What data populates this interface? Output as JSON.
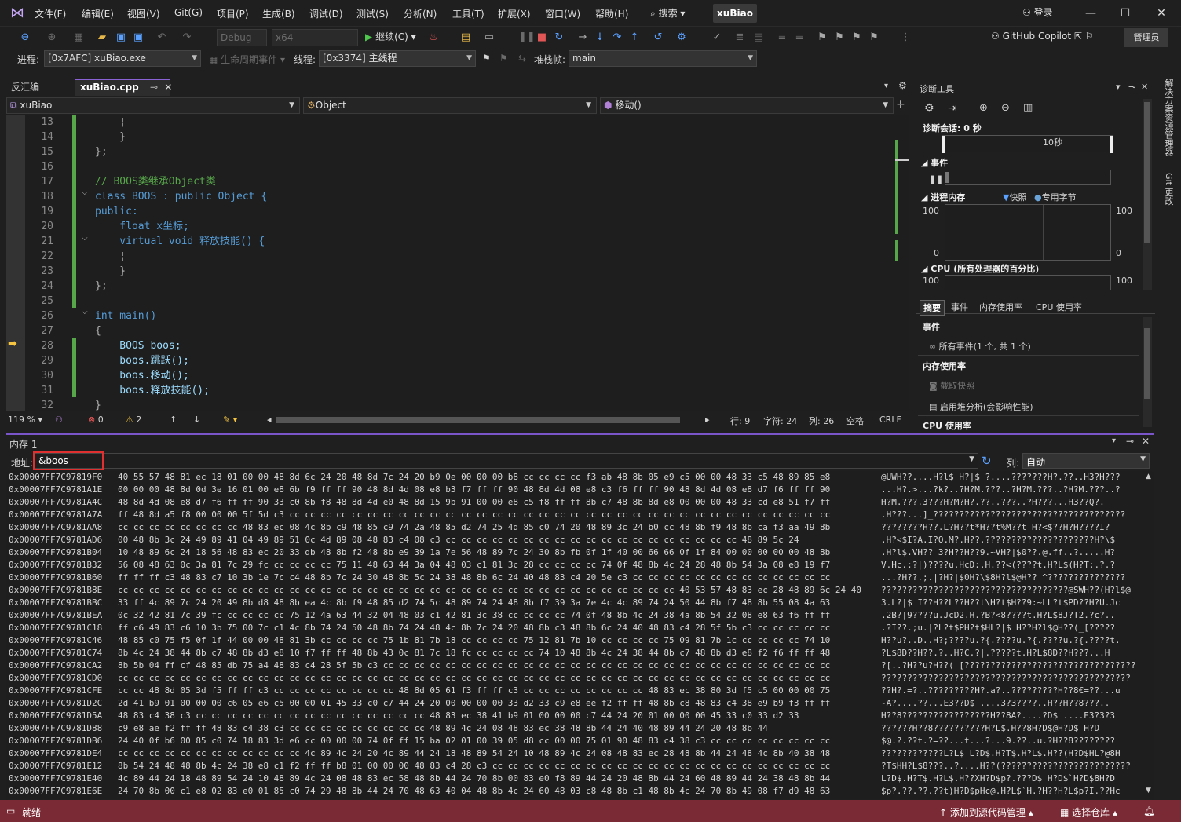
{
  "window": {
    "menu": [
      "文件(F)",
      "编辑(E)",
      "视图(V)",
      "Git(G)",
      "项目(P)",
      "生成(B)",
      "调试(D)",
      "测试(S)",
      "分析(N)",
      "工具(T)",
      "扩展(X)",
      "窗口(W)",
      "帮助(H)"
    ],
    "search_label": "搜索",
    "solution_name": "xuBiao",
    "login_label": "登录",
    "minimize": "—",
    "maximize": "☐",
    "close": "✕"
  },
  "toolbar": {
    "config": "Debug",
    "platform": "x64",
    "continue_label": "继续(C)",
    "copilot_label": "GitHub Copilot",
    "admin_label": "管理员"
  },
  "debug_location": {
    "process_label": "进程:",
    "process_value": "[0x7AFC] xuBiao.exe",
    "lifecycle_label": "生命周期事件",
    "thread_label": "线程:",
    "thread_value": "[0x3374] 主线程",
    "stackframe_label": "堆栈帧:",
    "stackframe_value": "main"
  },
  "tabs": {
    "disassembly": "反汇编",
    "code_file": "xuBiao.cpp"
  },
  "navbar": {
    "project": "xuBiao",
    "scope": "Object",
    "member": "移动()"
  },
  "code_lines": [
    {
      "n": "13",
      "t": "    ¦"
    },
    {
      "n": "14",
      "t": "    }"
    },
    {
      "n": "15",
      "t": "};"
    },
    {
      "n": "16",
      "t": ""
    },
    {
      "n": "17",
      "t": "// BOOS类继承Object类"
    },
    {
      "n": "18",
      "t": "class BOOS : public Object {"
    },
    {
      "n": "19",
      "t": "public:"
    },
    {
      "n": "20",
      "t": "    float x坐标;"
    },
    {
      "n": "21",
      "t": "    virtual void 释放技能() {"
    },
    {
      "n": "22",
      "t": "    ¦"
    },
    {
      "n": "23",
      "t": "    }"
    },
    {
      "n": "24",
      "t": "};"
    },
    {
      "n": "25",
      "t": ""
    },
    {
      "n": "26",
      "t": "int main()"
    },
    {
      "n": "27",
      "t": "{"
    },
    {
      "n": "28",
      "t": "    BOOS boos;"
    },
    {
      "n": "29",
      "t": "    boos.跳跃();"
    },
    {
      "n": "30",
      "t": "    boos.移动();"
    },
    {
      "n": "31",
      "t": "    boos.释放技能();"
    },
    {
      "n": "32",
      "t": "}"
    }
  ],
  "editor_status": {
    "zoom": "119 %",
    "errors": "0",
    "warnings": "2",
    "line": "行: 9",
    "char": "字符: 24",
    "col": "列: 26",
    "whitespace": "空格",
    "eol": "CRLF"
  },
  "diagnostics": {
    "title": "诊断工具",
    "session": "诊断会话: 0 秒",
    "timeline_label": "10秒",
    "events_label": "事件",
    "proc_mem_label": "进程内存",
    "snapshot_label": "快照",
    "private_bytes_label": "专用字节",
    "mem_max": "100",
    "mem_min": "0",
    "cpu_label": "CPU (所有处理器的百分比)",
    "cpu_max": "100",
    "tabs": [
      "摘要",
      "事件",
      "内存使用率",
      "CPU 使用率"
    ],
    "sec_events": "事件",
    "all_events": "所有事件(1 个, 共 1 个)",
    "sec_memory": "内存使用率",
    "take_snapshot": "截取快照",
    "heap_profiling": "启用堆分析(会影响性能)",
    "sec_cpu": "CPU 使用率"
  },
  "side_tabs": [
    "解决方案资源管理器",
    "Git 更改"
  ],
  "memory": {
    "title": "内存 1",
    "address_label": "地址:",
    "address_value": "&boos",
    "columns_label": "列:",
    "columns_value": "自动",
    "rows": [
      {
        "a": "0x00007FF7C97819F0",
        "h": "40 55 57 48 81 ec 18 01 00 00 48 8d 6c 24 20 48 8d 7c 24 20 b9 0e 00 00 00 b8 cc cc cc cc f3 ab 48 8b 05 e9 c5 00 00 48 33 c5 48 89 85 e8",
        "t": "@UWH??....H?l$ H?|$ ?....???????H?.??..H3?H???"
      },
      {
        "a": "0x00007FF7C9781A1E",
        "h": "00 00 00 48 8d 0d 3e 16 01 00 e8 6b f9 ff ff 90 48 8d 4d 08 e8 b3 f7 ff ff 90 48 8d 4d 08 e8 c3 f6 ff ff 90 48 8d 4d 08 e8 d7 f6 ff ff 90",
        "t": "...H?.>...?k?..?H?M.???..?H?M.???..?H?M.???..?"
      },
      {
        "a": "0x00007FF7C9781A4C",
        "h": "48 8d 4d 08 e8 d7 f6 ff ff 90 33 c0 8b f8 48 8d 4d e0 48 8d 15 9b 91 00 00 e8 c5 f8 ff ff 8b c7 48 8b 8d e8 00 00 00 48 33 cd e8 51 f7 ff",
        "t": "H?M.???.3???H?M?H?.??..???..?H???...H3??Q?."
      },
      {
        "a": "0x00007FF7C9781A7A",
        "h": "ff 48 8d a5 f8 00 00 00 5f 5d c3 cc cc cc cc cc cc cc cc cc cc cc cc cc cc cc cc cc cc cc cc cc cc cc cc cc cc cc cc cc cc cc cc cc cc cc",
        "t": ".H???...]_?????????????????????????????????????"
      },
      {
        "a": "0x00007FF7C9781AA8",
        "h": "cc cc cc cc cc cc cc cc 48 83 ec 08 4c 8b c9 48 85 c9 74 2a 48 85 d2 74 25 4d 85 c0 74 20 48 89 3c 24 b0 cc 48 8b f9 48 8b ca f3 aa 49 8b",
        "t": "????????H??.L?H??t*H??t%M??t H?<$??H?H????I?"
      },
      {
        "a": "0x00007FF7C9781AD6",
        "h": "00 48 8b 3c 24 49 89 41 04 49 89 51 0c 4d 89 08 48 83 c4 08 c3 cc cc cc cc cc cc cc cc cc cc cc cc cc cc cc cc cc cc cc 48 89 5c 24",
        "t": ".H?<$I?A.I?Q.M?.H??.?????????????????????H?\\$"
      },
      {
        "a": "0x00007FF7C9781B04",
        "h": "10 48 89 6c 24 18 56 48 83 ec 20 33 db 48 8b f2 48 8b e9 39 1a 7e 56 48 89 7c 24 30 8b fb 0f 1f 40 00 66 66 0f 1f 84 00 00 00 00 00 48 8b",
        "t": ".H?l$.VH?? 3?H??H??9.~VH?|$0??.@.ff..?.....H?"
      },
      {
        "a": "0x00007FF7C9781B32",
        "h": "56 08 48 63 0c 3a 81 7c 29 fc cc cc cc cc 75 11 48 63 44 3a 04 48 03 c1 81 3c 28 cc cc cc cc 74 0f 48 8b 4c 24 28 48 8b 54 3a 08 e8 19 f7",
        "t": "V.Hc.:?|)????u.HcD:.H.??<(????t.H?L$(H?T:.?.?"
      },
      {
        "a": "0x00007FF7C9781B60",
        "h": "ff ff ff c3 48 83 c7 10 3b 1e 7c c4 48 8b 7c 24 30 48 8b 5c 24 38 48 8b 6c 24 40 48 83 c4 20 5e c3 cc cc cc cc cc cc cc cc cc cc cc cc cc",
        "t": "...?H??.;.|?H?|$0H?\\$8H?l$@H?? ^???????????????"
      },
      {
        "a": "0x00007FF7C9781B8E",
        "h": "cc cc cc cc cc cc cc cc cc cc cc cc cc cc cc cc cc cc cc cc cc cc cc cc cc cc cc cc cc cc cc cc cc cc cc cc 40 53 57 48 83 ec 28 48 89 6c 24 40",
        "t": "????????????????????????????????????@SWH??(H?l$@"
      },
      {
        "a": "0x00007FF7C9781BBC",
        "h": "33 ff 4c 89 7c 24 20 49 8b d8 48 8b ea 4c 8b f9 48 85 d2 74 5c 48 89 74 24 48 8b f7 39 3a 7e 4c 4c 89 74 24 50 44 8b f7 48 8b 55 08 4a 63",
        "t": "3.L?|$ I??H??L??H??t\\H?t$H??9:~LL?t$PD??H?U.Jc"
      },
      {
        "a": "0x00007FF7C9781BEA",
        "h": "0c 32 42 81 7c 39 fc cc cc cc cc 75 12 4a 63 44 32 04 48 03 c1 42 81 3c 38 cc cc cc cc 74 0f 48 8b 4c 24 38 4a 8b 54 32 08 e8 63 f6 ff ff",
        "t": ".2B?|9????u.JcD2.H.?B?<8????t.H?L$8J?T2.?c?.."
      },
      {
        "a": "0x00007FF7C9781C18",
        "h": "ff c6 49 83 c6 10 3b 75 00 7c c1 4c 8b 74 24 50 48 8b 74 24 48 4c 8b 7c 24 20 48 8b c3 48 8b 6c 24 40 48 83 c4 28 5f 5b c3 cc cc cc cc cc",
        "t": ".?I??.;u.|?L?t$PH?t$HL?|$ H??H?l$@H??(_[?????"
      },
      {
        "a": "0x00007FF7C9781C46",
        "h": "48 85 c0 75 f5 0f 1f 44 00 00 48 81 3b cc cc cc cc 75 1b 81 7b 18 cc cc cc cc 75 12 81 7b 10 cc cc cc cc 75 09 81 7b 1c cc cc cc cc 74 10",
        "t": "H??u?..D..H?;????u.?{.????u.?{.????u.?{.????t."
      },
      {
        "a": "0x00007FF7C9781C74",
        "h": "8b 4c 24 38 44 8b c7 48 8b d3 e8 10 f7 ff ff 48 8b 43 0c 81 7c 18 fc cc cc cc cc 74 10 48 8b 4c 24 38 44 8b c7 48 8b d3 e8 f2 f6 ff ff 48",
        "t": "?L$8D??H??.?..H?C.?|.?????t.H?L$8D??H???...H"
      },
      {
        "a": "0x00007FF7C9781CA2",
        "h": "8b 5b 04 ff cf 48 85 db 75 a4 48 83 c4 28 5f 5b c3 cc cc cc cc cc cc cc cc cc cc cc cc cc cc cc cc cc cc cc cc cc cc cc cc cc cc cc cc cc",
        "t": "?[..?H??u?H??(_[?????????????????????????????????"
      },
      {
        "a": "0x00007FF7C9781CD0",
        "h": "cc cc cc cc cc cc cc cc cc cc cc cc cc cc cc cc cc cc cc cc cc cc cc cc cc cc cc cc cc cc cc cc cc cc cc cc cc cc cc cc cc cc cc cc cc cc",
        "t": "????????????????????????????????????????????????"
      },
      {
        "a": "0x00007FF7C9781CFE",
        "h": "cc cc 48 8d 05 3d f5 ff ff c3 cc cc cc cc cc cc cc cc 48 8d 05 61 f3 ff ff c3 cc cc cc cc cc cc cc cc 48 83 ec 38 80 3d f5 c5 00 00 00 75",
        "t": "??H?.=?..?????????H?.a?..?????????H??8€=??...u"
      },
      {
        "a": "0x00007FF7C9781D2C",
        "h": "2d 41 b9 01 00 00 00 c6 05 e6 c5 00 00 01 45 33 c0 c7 44 24 20 00 00 00 00 33 d2 33 c9 e8 ee f2 ff ff 48 8b c8 48 83 c4 38 e9 b9 f3 ff ff",
        "t": "-A?....??...E3??D$ ....3?3????..H??H??8???.."
      },
      {
        "a": "0x00007FF7C9781D5A",
        "h": "48 83 c4 38 c3 cc cc cc cc cc cc cc cc cc cc cc cc cc cc cc 48 83 ec 38 41 b9 01 00 00 00 c7 44 24 20 01 00 00 00 45 33 c0 33 d2 33",
        "t": "H??8?????????????????H??8A?....?D$ ....E3?3?3"
      },
      {
        "a": "0x00007FF7C9781D88",
        "h": "c9 e8 ae f2 ff ff 48 83 c4 38 c3 cc cc cc cc cc cc cc cc cc 48 89 4c 24 08 48 83 ec 38 48 8b 44 24 40 48 89 44 24 20 48 8b 44",
        "t": "??????H??8??????????H?L$.H??8H?D$@H?D$ H?D"
      },
      {
        "a": "0x00007FF7C9781DB6",
        "h": "24 40 0f b6 00 85 c0 74 18 83 3d e6 cc 00 00 00 74 0f ff 15 ba 02 01 00 39 05 d8 cc 00 00 75 01 90 48 83 c4 38 c3 cc cc cc cc cc cc cc cc",
        "t": "$@.?.??t.?=??...t...?...9.??..u.?H??8????????"
      },
      {
        "a": "0x00007FF7C9781DE4",
        "h": "cc cc cc cc cc cc cc cc cc cc cc cc 4c 89 4c 24 20 4c 89 44 24 18 48 89 54 24 10 48 89 4c 24 08 48 83 ec 28 48 8b 44 24 48 4c 8b 40 38 48",
        "t": "????????????L?L$ L?D$.H?T$.H?L$.H??(H?D$HL?@8H"
      },
      {
        "a": "0x00007FF7C9781E12",
        "h": "8b 54 24 48 48 8b 4c 24 38 e8 c1 f2 ff ff b8 01 00 00 00 48 83 c4 28 c3 cc cc cc cc cc cc cc cc cc cc cc cc cc cc cc cc cc cc cc cc cc cc",
        "t": "?T$HH?L$8???..?....H??(?????????????????????????"
      },
      {
        "a": "0x00007FF7C9781E40",
        "h": "4c 89 44 24 18 48 89 54 24 10 48 89 4c 24 08 48 83 ec 58 48 8b 44 24 70 8b 00 83 e0 f8 89 44 24 20 48 8b 44 24 60 48 89 44 24 38 48 8b 44",
        "t": "L?D$.H?T$.H?L$.H??XH?D$p?.???D$ H?D$`H?D$8H?D"
      },
      {
        "a": "0x00007FF7C9781E6E",
        "h": "24 70 8b 00 c1 e8 02 83 e0 01 85 c0 74 29 48 8b 44 24 70 48 63 40 04 48 8b 4c 24 60 48 03 c8 48 8b c1 48 8b 4c 24 70 8b 49 08 f7 d9 48 63",
        "t": "$p?.??.??.??t)H?D$pHc@.H?L$`H.?H??H?L$p?I.??Hc"
      }
    ]
  },
  "statusbar": {
    "ready": "就绪",
    "add_source": "添加到源代码管理",
    "select_repo": "选择仓库"
  }
}
